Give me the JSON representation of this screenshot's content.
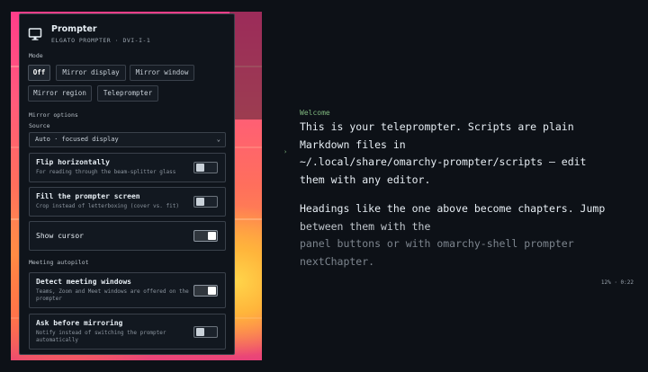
{
  "panel": {
    "title": "Prompter",
    "subtitle": "ELGATO PROMPTER · DVI-I-1",
    "mode_label": "Mode",
    "modes": [
      "Off",
      "Mirror display",
      "Mirror window",
      "Mirror region",
      "Teleprompter"
    ],
    "active_mode": "Off",
    "mirror_options_label": "Mirror options",
    "source_label": "Source",
    "source_value": "Auto · focused display",
    "options": [
      {
        "title": "Flip horizontally",
        "desc": "For reading through the beam-splitter glass",
        "on": false
      },
      {
        "title": "Fill the prompter screen",
        "desc": "Crop instead of letterboxing (cover vs. fit)",
        "on": false
      },
      {
        "title": "Show cursor",
        "desc": "",
        "on": true
      }
    ],
    "autopilot_label": "Meeting autopilot",
    "autopilot": [
      {
        "title": "Detect meeting windows",
        "desc": "Teams, Zoom and Meet windows are offered on the prompter",
        "on": true
      },
      {
        "title": "Ask before mirroring",
        "desc": "Notify instead of switching the prompter automatically",
        "on": false
      }
    ]
  },
  "preview": {
    "heading": "Welcome",
    "para1": [
      "This is your teleprompter. Scripts are plain",
      "Markdown files in",
      "~/.local/share/omarchy-prompter/scripts — edit",
      "them with any editor."
    ],
    "para2": [
      "Headings like the one above become chapters. Jump",
      "between them with the",
      "panel buttons or with omarchy-shell prompter",
      "nextChapter."
    ],
    "caret": "›",
    "progress": "12% · 0:22"
  },
  "colors": {
    "accent_green": "#7fb77e",
    "panel_bg": "#0f141b",
    "page_bg": "#0d1117"
  }
}
